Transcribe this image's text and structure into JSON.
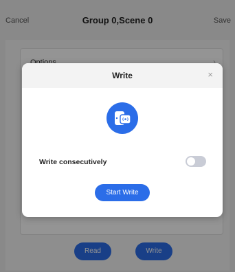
{
  "header": {
    "cancel_label": "Cancel",
    "title": "Group 0,Scene 0",
    "save_label": "Save"
  },
  "options": {
    "label": "Options"
  },
  "bottom_actions": {
    "read_label": "Read",
    "write_label": "Write"
  },
  "dialog": {
    "title": "Write",
    "close_icon": "×",
    "icon": "nfc-tag-icon",
    "consecutive_label": "Write consecutively",
    "consecutive_enabled": false,
    "start_label": "Start Write"
  },
  "colors": {
    "accent": "#2b6de8",
    "toggle_off": "#c9ccd6"
  }
}
